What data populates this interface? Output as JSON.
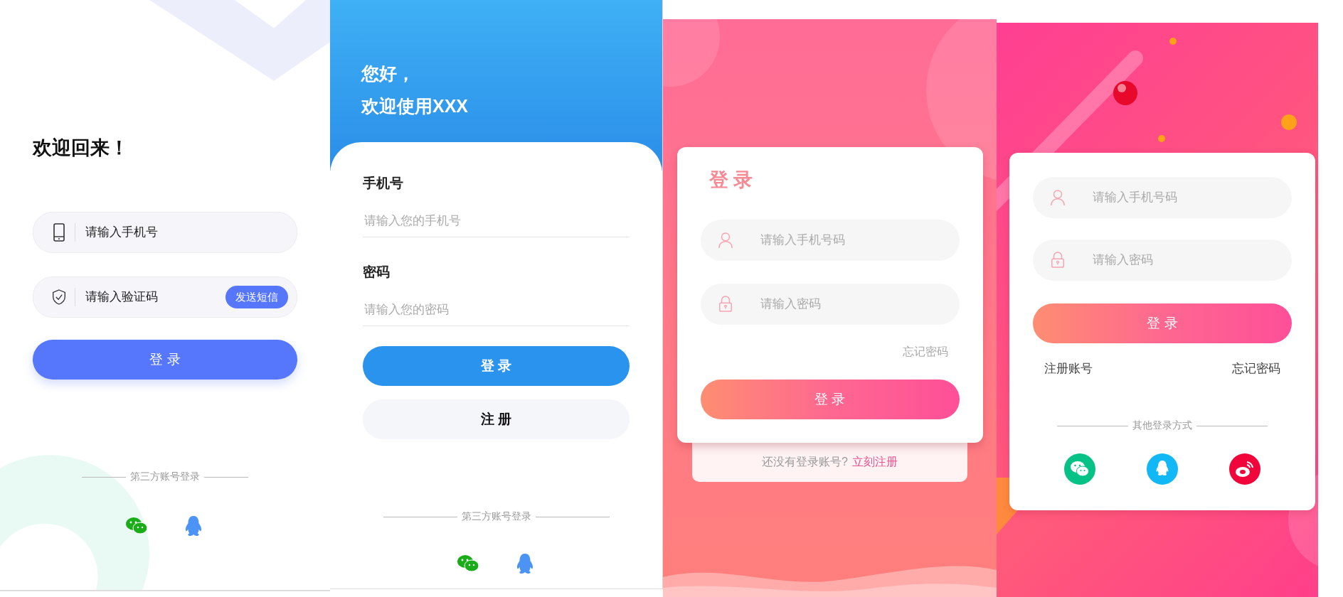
{
  "screens": [
    {
      "kind": "sms",
      "title": "欢迎回来！",
      "phone": {
        "placeholder": "请输入手机号"
      },
      "code": {
        "placeholder": "请输入验证码",
        "send_button": "发送短信"
      },
      "login_button": "登 录",
      "divider": "第三方账号登录"
    },
    {
      "kind": "blue",
      "greeting": [
        "您好，",
        "欢迎使用XXX"
      ],
      "fields": [
        {
          "label": "手机号",
          "placeholder": "请输入您的手机号"
        },
        {
          "label": "密码",
          "placeholder": "请输入您的密码"
        }
      ],
      "login_button": "登 录",
      "register_button": "注 册",
      "divider": "第三方账号登录"
    },
    {
      "kind": "card",
      "title": "登 录",
      "fields": [
        {
          "placeholder": "请输入手机号码"
        },
        {
          "placeholder": "请输入密码"
        }
      ],
      "forgot_link": "忘记密码",
      "login_button": "登 录",
      "signup_prompt": "还没有登录账号?",
      "signup_link": "立刻注册"
    },
    {
      "kind": "card-social",
      "fields": [
        {
          "placeholder": "请输入手机号码"
        },
        {
          "placeholder": "请输入密码"
        }
      ],
      "login_button": "登 录",
      "register_link": "注册账号",
      "forgot_link": "忘记密码",
      "divider": "其他登录方式"
    }
  ]
}
